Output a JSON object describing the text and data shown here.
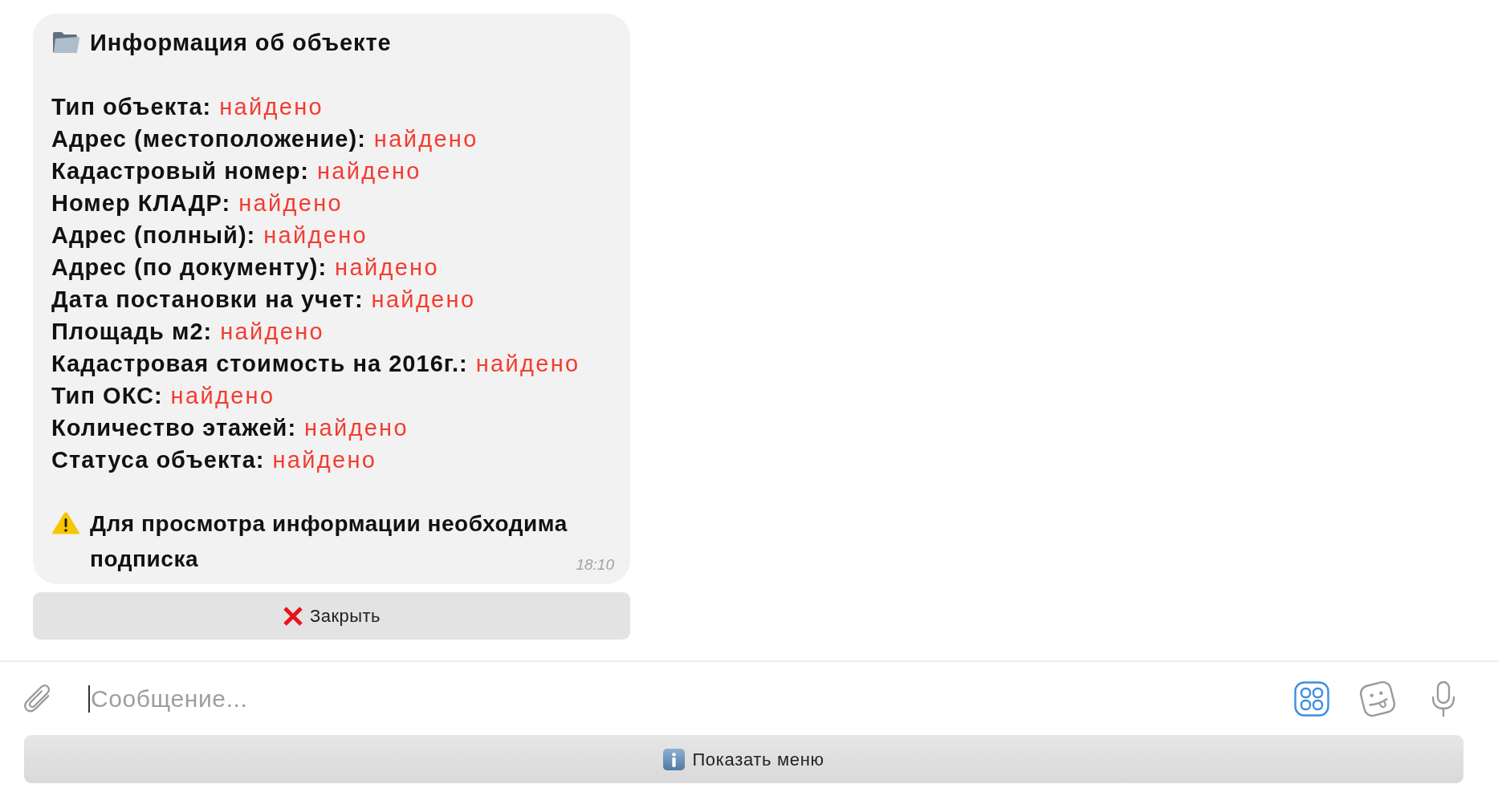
{
  "message": {
    "title": "Информация об объекте",
    "fields": [
      {
        "label": "Тип объекта:",
        "value": "найдено"
      },
      {
        "label": "Адрес (местоположение):",
        "value": "найдено"
      },
      {
        "label": "Кадастровый номер:",
        "value": "найдено"
      },
      {
        "label": "Номер КЛАДР:",
        "value": "найдено"
      },
      {
        "label": "Адрес (полный):",
        "value": "найдено"
      },
      {
        "label": "Адрес (по документу):",
        "value": "найдено"
      },
      {
        "label": "Дата постановки на учет:",
        "value": "найдено"
      },
      {
        "label": "Площадь м2:",
        "value": "найдено"
      },
      {
        "label": "Кадастровая стоимость на 2016г.:",
        "value": "найдено"
      },
      {
        "label": "Тип ОКС:",
        "value": "найдено"
      },
      {
        "label": "Количество этажей:",
        "value": "найдено"
      },
      {
        "label": "Статуса объекта:",
        "value": "найдено"
      }
    ],
    "notice": "Для просмотра информации необходима подписка",
    "time": "18:10"
  },
  "inline_buttons": [
    {
      "label": "Закрыть"
    }
  ],
  "composer": {
    "placeholder": "Сообщение..."
  },
  "menu_button": {
    "label": "Показать меню"
  }
}
